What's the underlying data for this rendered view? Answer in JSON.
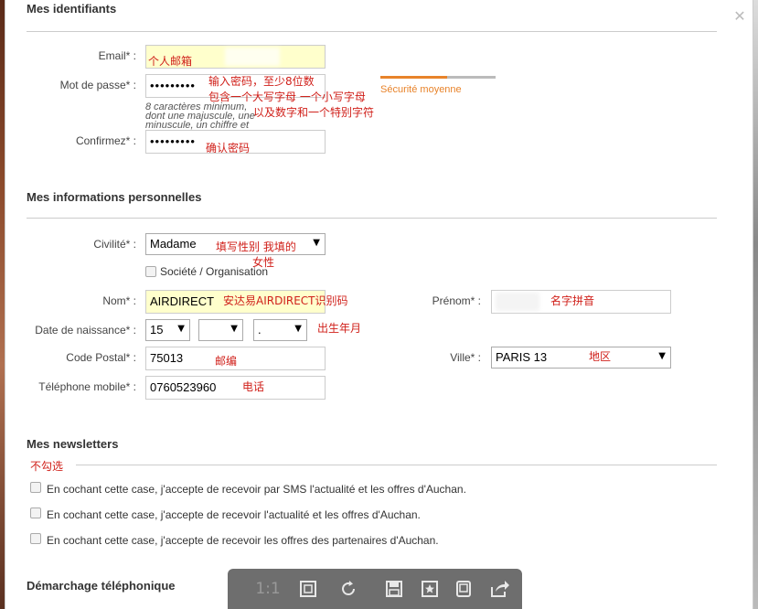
{
  "section_identifiers": {
    "title": "Mes identifiants"
  },
  "email": {
    "label": "Email* :",
    "value": "",
    "annotation": "个人邮箱"
  },
  "password": {
    "label": "Mot de passe* :",
    "value": "•••••••••",
    "annotation_line1": "输入密码，至少8位数",
    "annotation_line2": "包含一个大写字母 一个小写字母",
    "annotation_line3": "以及数字和一个特别字符",
    "hint_line1": "8 caractères minimum,",
    "hint_line2": "dont une majuscule, une",
    "hint_line3": "minuscule, un chiffre et",
    "strength_label": "Sécurité moyenne",
    "strength_fraction": 0.58,
    "strength_color": "#e8832a"
  },
  "confirm": {
    "label": "Confirmez* :",
    "value": "•••••••••",
    "annotation": "确认密码"
  },
  "section_personal": {
    "title": "Mes informations personnelles"
  },
  "civility": {
    "label": "Civilité* :",
    "value": "Madame",
    "annotation_line1": "填写性别 我填的",
    "annotation_line2": "女性",
    "company_label": "Société / Organisation"
  },
  "nom": {
    "label": "Nom* :",
    "value": "AIRDIRECT",
    "annotation": "安达易AIRDIRECT识别码"
  },
  "prenom": {
    "label": "Prénom* :",
    "value": "",
    "annotation": "名字拼音"
  },
  "birth": {
    "label": "Date de naissance* :",
    "day": "15",
    "month": "",
    "year": ".",
    "annotation": "出生年月"
  },
  "postal": {
    "label": "Code Postal* :",
    "value": "75013",
    "annotation": "邮编"
  },
  "ville": {
    "label": "Ville* :",
    "value": "PARIS 13",
    "annotation": "地区"
  },
  "phone": {
    "label": "Téléphone mobile* :",
    "value": "0760523960",
    "annotation": "电话"
  },
  "section_newsletters": {
    "title": "Mes newsletters",
    "annotation": "不勾选"
  },
  "newsletters": [
    {
      "label": "En cochant cette case, j'accepte de recevoir par SMS l'actualité et les offres d'Auchan."
    },
    {
      "label": "En cochant cette case, j'accepte de recevoir l'actualité et les offres d'Auchan."
    },
    {
      "label": "En cochant cette case, j'accepte de recevoir les offres des partenaires d'Auchan."
    }
  ],
  "section_phone": {
    "title": "Démarchage téléphonique"
  },
  "toolbar": {
    "ratio_label": "1:1",
    "icons": [
      "fit-icon",
      "rotate-icon",
      "save-icon",
      "favorite-icon",
      "slideshow-icon",
      "share-icon"
    ]
  },
  "colors": {
    "annotation": "#d0201a",
    "highlight": "#ffffcc",
    "toolbar": "#6e6e6e"
  }
}
